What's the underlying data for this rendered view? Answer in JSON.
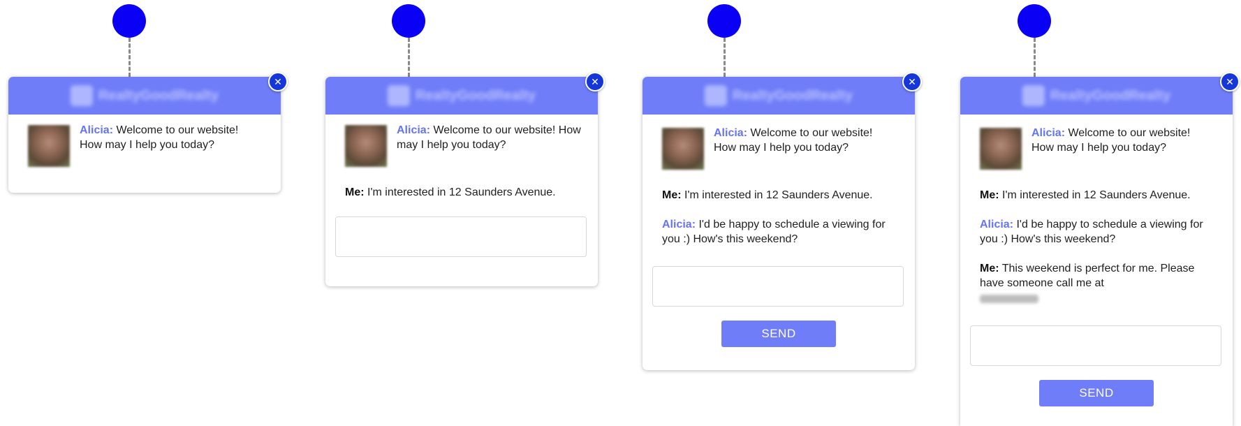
{
  "brand": {
    "logo_text": "RealtyGoodRealty",
    "header_color": "#6f7df8",
    "accent_color": "#6574f2",
    "step_dot_color": "#0a00f5"
  },
  "icons": {
    "close": "close-icon",
    "avatar": "agent-avatar"
  },
  "widgets": [
    {
      "close_label": "✕",
      "agent_name": "Alicia:",
      "agent_greeting": "Welcome to our website! How may I help you today?"
    },
    {
      "close_label": "✕",
      "agent_name": "Alicia:",
      "agent_greeting": "Welcome to our website! How may I help you today?",
      "me_name": "Me:",
      "me_message": "I'm interested in 12 Saunders Avenue.",
      "input_placeholder": ""
    },
    {
      "close_label": "✕",
      "agent_name": "Alicia:",
      "agent_greeting": "Welcome to our website! How may I help you today?",
      "me_name": "Me:",
      "me_message": "I'm interested in 12 Saunders Avenue.",
      "agent_reply": "I'd be happy to schedule a viewing for you :) How's this weekend?",
      "input_placeholder": "",
      "send_label": "SEND"
    },
    {
      "close_label": "✕",
      "agent_name": "Alicia:",
      "agent_greeting": "Welcome to our website! How may I help you today?",
      "me_name": "Me:",
      "me_message": "I'm interested in 12 Saunders Avenue.",
      "agent_reply": "I'd be happy to schedule a viewing for you :) How's this weekend?",
      "me_name_2": "Me:",
      "me_message_2": "This weekend is perfect for me. Please have someone call me at",
      "input_placeholder": "",
      "send_label": "SEND"
    }
  ]
}
